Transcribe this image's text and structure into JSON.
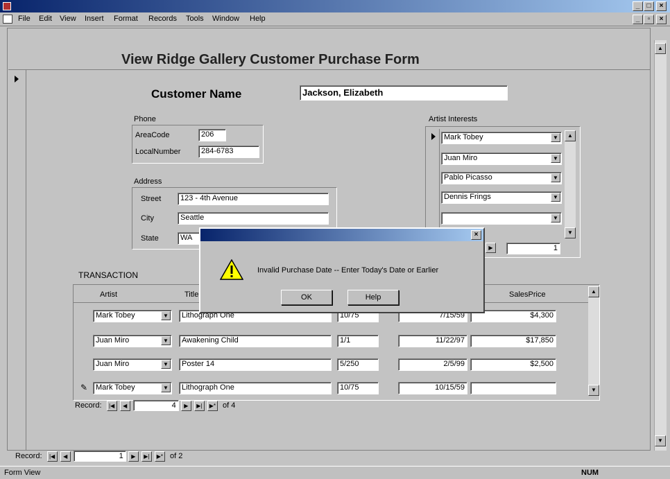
{
  "menu": [
    "File",
    "Edit",
    "View",
    "Insert",
    "Format",
    "Records",
    "Tools",
    "Window",
    "Help"
  ],
  "form": {
    "title": "View Ridge Gallery Customer Purchase Form",
    "customer_name_label": "Customer Name",
    "customer_name": "Jackson, Elizabeth",
    "phone_label": "Phone",
    "areacode_label": "AreaCode",
    "areacode": "206",
    "localnumber_label": "LocalNumber",
    "localnumber": "284-6783",
    "address_label": "Address",
    "street_label": "Street",
    "street": "123 - 4th Avenue",
    "city_label": "City",
    "city": "Seattle",
    "state_label": "State",
    "state": "WA",
    "artist_interests_label": "Artist Interests",
    "artist_interests": [
      "Mark Tobey",
      "Juan Miro",
      "Pablo Picasso",
      "Dennis Frings",
      ""
    ],
    "interests_record": "1",
    "transaction_label": "TRANSACTION"
  },
  "transaction": {
    "headers": [
      "Artist",
      "Title",
      "",
      "",
      "SalesPrice"
    ],
    "rows": [
      {
        "artist": "Mark Tobey",
        "title": "Lithograph One",
        "copy": "10/75",
        "date": "7/15/59",
        "price": "$4,300"
      },
      {
        "artist": "Juan Miro",
        "title": "Awakening Child",
        "copy": "1/1",
        "date": "11/22/97",
        "price": "$17,850"
      },
      {
        "artist": "Juan Miro",
        "title": "Poster 14",
        "copy": "5/250",
        "date": "2/5/99",
        "price": "$2,500"
      },
      {
        "artist": "Mark Tobey",
        "title": "Lithograph One",
        "copy": "10/75",
        "date": "10/15/59",
        "price": ""
      }
    ],
    "record_label": "Record:",
    "record_current": "4",
    "record_of": "of  4"
  },
  "dialog": {
    "message": "Invalid Purchase Date -- Enter Today's Date or Earlier",
    "ok_label": "OK",
    "help_label": "Help",
    "icon": "warning-icon"
  },
  "navigation": {
    "record_label": "Record:",
    "record_current": "1",
    "record_of": "of  2"
  },
  "status": {
    "left": "Form View",
    "right": "NUM"
  }
}
